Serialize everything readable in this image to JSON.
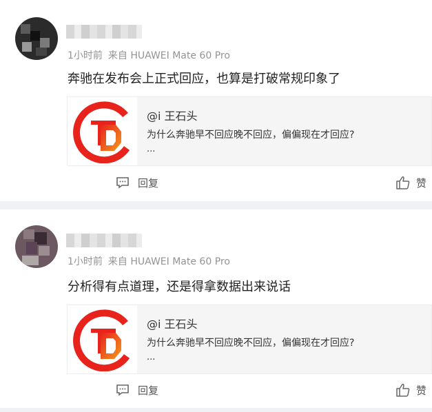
{
  "comments": [
    {
      "meta": {
        "time": "1小时前",
        "source": "来自 HUAWEI Mate 60 Pro"
      },
      "text": "奔驰在发布会上正式回应，也算是打破常规印象了",
      "quote": {
        "author": "@i 王石头",
        "text": "为什么奔驰早不回应晚不回应，偏偏现在才回应?",
        "more": "..."
      },
      "actions": {
        "reply": "回复",
        "like": "赞"
      }
    },
    {
      "meta": {
        "time": "1小时前",
        "source": "来自 HUAWEI Mate 60 Pro"
      },
      "text": "分析得有点道理，还是得拿数据出来说话",
      "quote": {
        "author": "@i 王石头",
        "text": "为什么奔驰早不回应晚不回应，偏偏现在才回应?",
        "more": "..."
      },
      "actions": {
        "reply": "回复",
        "like": "赞"
      }
    }
  ],
  "icons": {
    "reply": "comment-icon",
    "like": "thumbs-up-icon",
    "quote_logo": "logo-icon"
  },
  "colors": {
    "logo_red": "#e8231c",
    "logo_orange": "#f39a1f",
    "divider": "#f0f1f4"
  }
}
